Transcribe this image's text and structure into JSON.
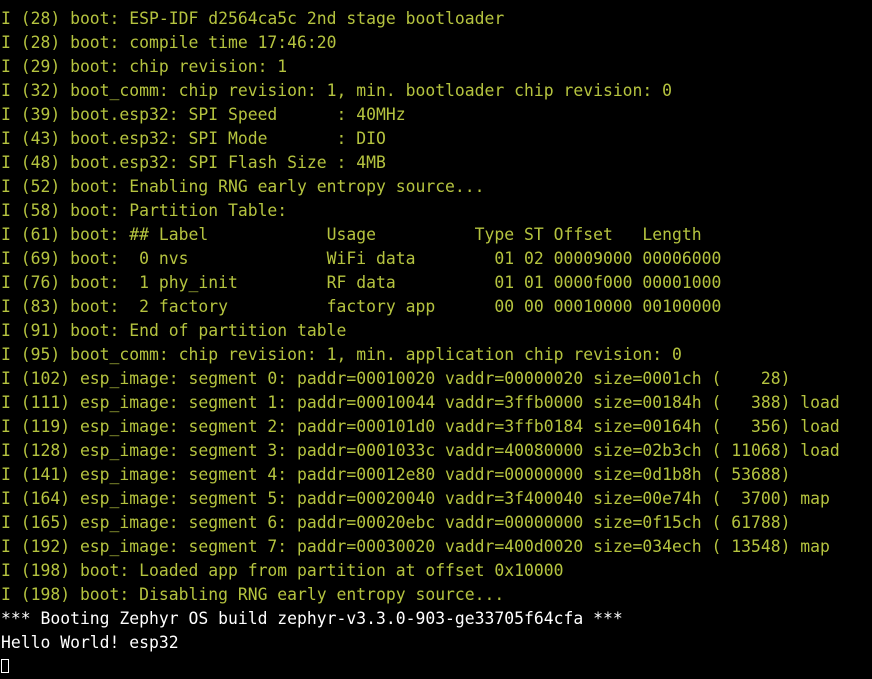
{
  "terminal": {
    "colors": {
      "background": "#000000",
      "info_text": "#b5c33f",
      "plain_text": "#ffffff"
    },
    "lines": [
      {
        "style": "info",
        "text": "I (28) boot: ESP-IDF d2564ca5c 2nd stage bootloader"
      },
      {
        "style": "info",
        "text": "I (28) boot: compile time 17:46:20"
      },
      {
        "style": "info",
        "text": "I (29) boot: chip revision: 1"
      },
      {
        "style": "info",
        "text": "I (32) boot_comm: chip revision: 1, min. bootloader chip revision: 0"
      },
      {
        "style": "info",
        "text": "I (39) boot.esp32: SPI Speed      : 40MHz"
      },
      {
        "style": "info",
        "text": "I (43) boot.esp32: SPI Mode       : DIO"
      },
      {
        "style": "info",
        "text": "I (48) boot.esp32: SPI Flash Size : 4MB"
      },
      {
        "style": "info",
        "text": "I (52) boot: Enabling RNG early entropy source..."
      },
      {
        "style": "info",
        "text": "I (58) boot: Partition Table:"
      },
      {
        "style": "info",
        "text": "I (61) boot: ## Label            Usage          Type ST Offset   Length"
      },
      {
        "style": "info",
        "text": "I (69) boot:  0 nvs              WiFi data        01 02 00009000 00006000"
      },
      {
        "style": "info",
        "text": "I (76) boot:  1 phy_init         RF data          01 01 0000f000 00001000"
      },
      {
        "style": "info",
        "text": "I (83) boot:  2 factory          factory app      00 00 00010000 00100000"
      },
      {
        "style": "info",
        "text": "I (91) boot: End of partition table"
      },
      {
        "style": "info",
        "text": "I (95) boot_comm: chip revision: 1, min. application chip revision: 0"
      },
      {
        "style": "info",
        "text": "I (102) esp_image: segment 0: paddr=00010020 vaddr=00000020 size=0001ch (    28)"
      },
      {
        "style": "info",
        "text": "I (111) esp_image: segment 1: paddr=00010044 vaddr=3ffb0000 size=00184h (   388) load"
      },
      {
        "style": "info",
        "text": "I (119) esp_image: segment 2: paddr=000101d0 vaddr=3ffb0184 size=00164h (   356) load"
      },
      {
        "style": "info",
        "text": "I (128) esp_image: segment 3: paddr=0001033c vaddr=40080000 size=02b3ch ( 11068) load"
      },
      {
        "style": "info",
        "text": "I (141) esp_image: segment 4: paddr=00012e80 vaddr=00000000 size=0d1b8h ( 53688)"
      },
      {
        "style": "info",
        "text": "I (164) esp_image: segment 5: paddr=00020040 vaddr=3f400040 size=00e74h (  3700) map"
      },
      {
        "style": "info",
        "text": "I (165) esp_image: segment 6: paddr=00020ebc vaddr=00000000 size=0f15ch ( 61788)"
      },
      {
        "style": "info",
        "text": "I (192) esp_image: segment 7: paddr=00030020 vaddr=400d0020 size=034ech ( 13548) map"
      },
      {
        "style": "info",
        "text": "I (198) boot: Loaded app from partition at offset 0x10000"
      },
      {
        "style": "info",
        "text": "I (198) boot: Disabling RNG early entropy source..."
      },
      {
        "style": "plain",
        "text": "*** Booting Zephyr OS build zephyr-v3.3.0-903-ge33705f64cfa ***"
      },
      {
        "style": "plain",
        "text": "Hello World! esp32"
      }
    ],
    "cursor_icon": "block-cursor-outline"
  }
}
